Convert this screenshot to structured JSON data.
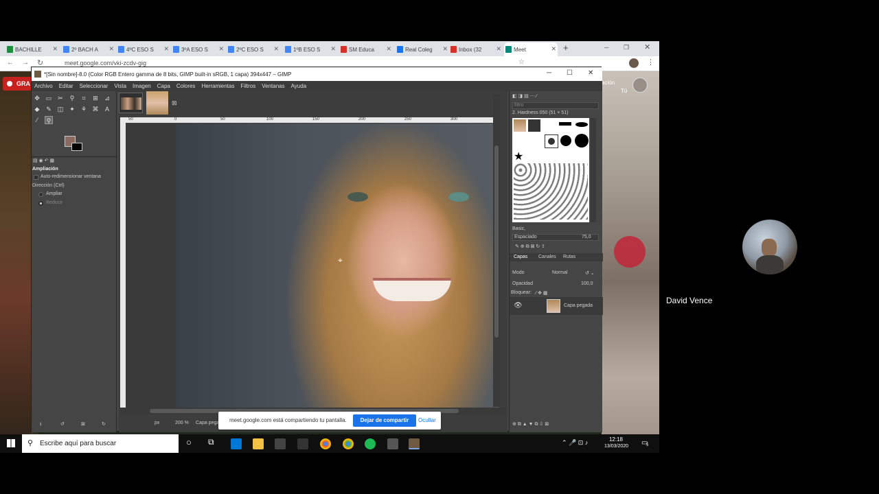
{
  "browser": {
    "tabs": [
      {
        "label": "BACHILLE",
        "color": "#1e8e3e"
      },
      {
        "label": "2º BACH A",
        "color": "#4285f4"
      },
      {
        "label": "4ºC ESO S",
        "color": "#4285f4"
      },
      {
        "label": "3ºA ESO S",
        "color": "#4285f4"
      },
      {
        "label": "2ºC ESO S",
        "color": "#4285f4"
      },
      {
        "label": "1ºB ESO S",
        "color": "#4285f4"
      },
      {
        "label": "SM Educa",
        "color": "#d93025"
      },
      {
        "label": "Real Coleg",
        "color": "#1a73e8"
      },
      {
        "label": "Inbox (32",
        "color": "#d93025"
      },
      {
        "label": "Meet",
        "color": "#00897b"
      }
    ],
    "url": "meet.google.com/vki-zcdv-gig"
  },
  "gimp": {
    "title": "*[Sin nombre]-8.0 (Color RGB Entero gamma de 8 bits, GIMP built-in sRGB, 1 capa) 394x447 – GIMP",
    "menu": [
      "Archivo",
      "Editar",
      "Seleccionar",
      "Vista",
      "Imagen",
      "Capa",
      "Colores",
      "Herramientas",
      "Filtros",
      "Ventanas",
      "Ayuda"
    ],
    "tool_options": {
      "title": "Ampliación",
      "auto_resize": "Auto-redimensionar ventana",
      "direction": "Dirección (Ctrl)",
      "opt_zoom_in": "Ampliar",
      "opt_zoom_out": "Reducir"
    },
    "ruler_ticks": [
      "50",
      "0",
      "50",
      "100",
      "150",
      "200",
      "250",
      "300"
    ],
    "status": {
      "unit": "px",
      "zoom": "200 %",
      "layer_label": "Capa pega"
    },
    "brushes": {
      "filter": "filtro",
      "brush_name": "2. Hardness 050 (51 × 51)",
      "preset": "Basic,",
      "spacing_label": "Espaciado",
      "spacing_value": "75,0"
    },
    "layers": {
      "tabs": [
        "Capas",
        "Canales",
        "Rutas"
      ],
      "mode_label": "Modo",
      "mode_value": "Normal",
      "opacity_label": "Opacidad",
      "opacity_value": "100,0",
      "lock_label": "Bloquear:",
      "layer_name": "Capa pegada"
    }
  },
  "meet": {
    "share_message": "meet.google.com está compartiendo tu pantalla.",
    "stop_label": "Dejar de compartir",
    "hide_label": "Ocultar",
    "left_badge": "GRA",
    "participant_name": "David Vence",
    "top_right_text": "ación",
    "you_label": "Tú"
  },
  "taskbar": {
    "search_placeholder": "Escribe aquí para buscar",
    "time": "12:18",
    "date": "13/03/2020",
    "notifications": "5"
  }
}
